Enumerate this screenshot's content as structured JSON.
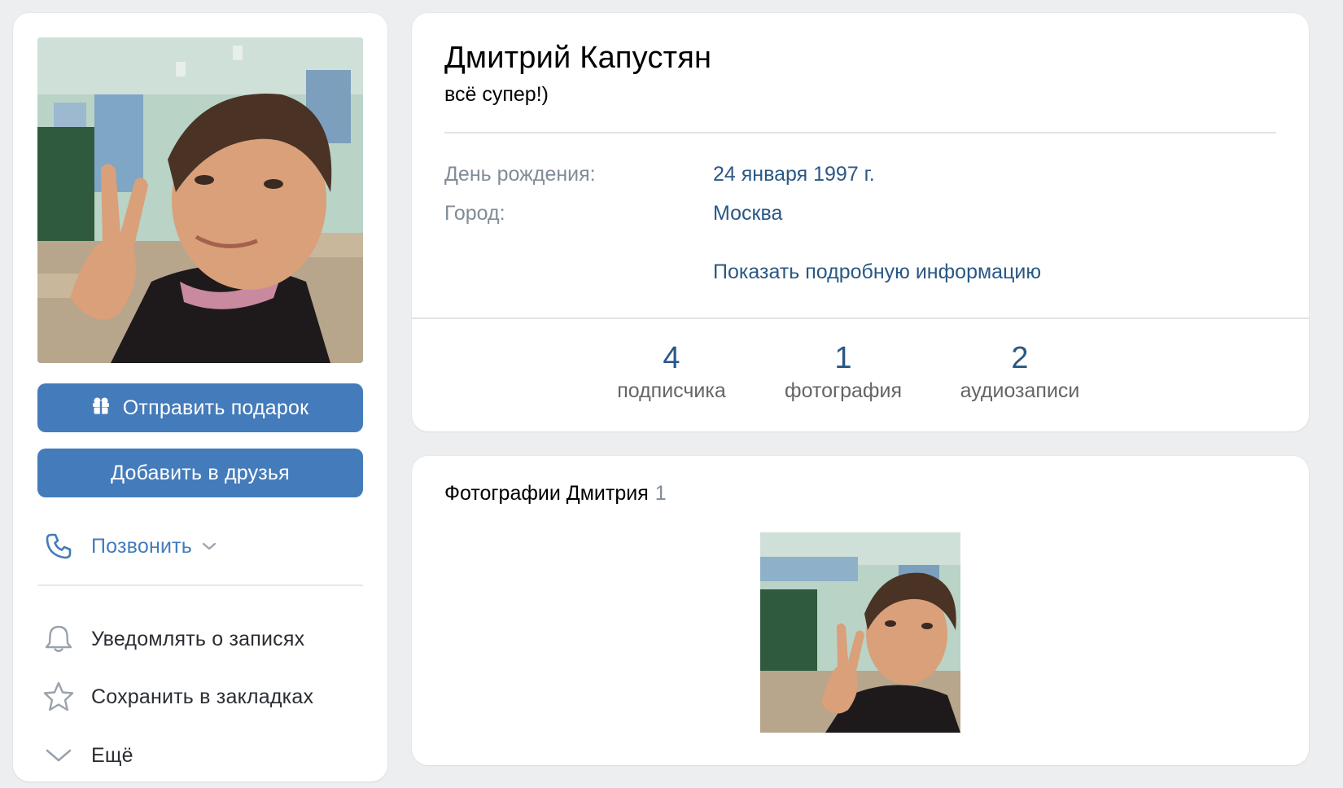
{
  "profile": {
    "name": "Дмитрий Капустян",
    "status": "всё супер!)",
    "info": [
      {
        "label": "День рождения:",
        "value": "24 января 1997 г."
      },
      {
        "label": "Город:",
        "value": "Москва"
      }
    ],
    "more_info_link": "Показать подробную информацию",
    "counters": [
      {
        "number": "4",
        "caption": "подписчика"
      },
      {
        "number": "1",
        "caption": "фотография"
      },
      {
        "number": "2",
        "caption": "аудиозаписи"
      }
    ]
  },
  "left": {
    "gift_button": "Отправить подарок",
    "add_friend_button": "Добавить в друзья",
    "call_label": "Позвонить",
    "notify_label": "Уведомлять о записях",
    "bookmark_label": "Сохранить в закладках",
    "more_label": "Ещё"
  },
  "photos": {
    "title": "Фотографии Дмитрия",
    "count": "1"
  },
  "colors": {
    "button_blue": "#447bba",
    "link_blue": "#2a5885",
    "muted_gray": "#818c99",
    "page_bg": "#edeef0"
  },
  "icons": [
    "gift-icon",
    "phone-icon",
    "chevron-down-icon",
    "bell-icon",
    "star-icon"
  ]
}
